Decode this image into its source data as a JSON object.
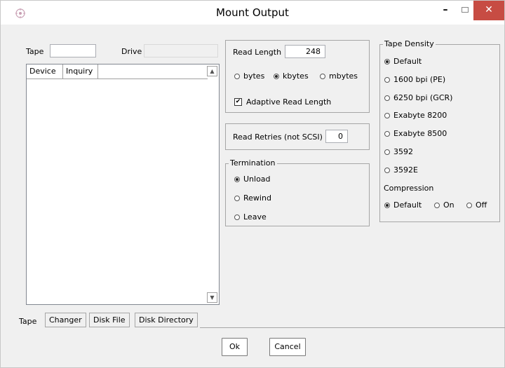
{
  "window": {
    "title": "Mount Output",
    "minimize": "–",
    "close": "✕",
    "accent_close": "#c74c43"
  },
  "tape_panel": {
    "tape_label": "Tape",
    "tape_value": "",
    "drive_label": "Drive",
    "drive_value": "",
    "columns": [
      "Device",
      "Inquiry"
    ]
  },
  "read_length": {
    "label": "Read Length",
    "value": "248",
    "units": [
      {
        "label": "bytes",
        "selected": false
      },
      {
        "label": "kbytes",
        "selected": true
      },
      {
        "label": "mbytes",
        "selected": false
      }
    ],
    "adaptive_label": "Adaptive Read Length",
    "adaptive_checked": true
  },
  "read_retries": {
    "label": "Read Retries (not SCSI)",
    "value": "0"
  },
  "termination": {
    "title": "Termination",
    "options": [
      {
        "label": "Unload",
        "selected": true
      },
      {
        "label": "Rewind",
        "selected": false
      },
      {
        "label": "Leave",
        "selected": false
      }
    ]
  },
  "tape_density": {
    "title": "Tape Density",
    "options": [
      {
        "label": "Default",
        "selected": true
      },
      {
        "label": "1600 bpi (PE)",
        "selected": false
      },
      {
        "label": "6250 bpi (GCR)",
        "selected": false
      },
      {
        "label": "Exabyte 8200",
        "selected": false
      },
      {
        "label": "Exabyte 8500",
        "selected": false
      },
      {
        "label": "3592",
        "selected": false
      },
      {
        "label": "3592E",
        "selected": false
      }
    ],
    "compression_label": "Compression",
    "compression": [
      {
        "label": "Default",
        "selected": true
      },
      {
        "label": "On",
        "selected": false
      },
      {
        "label": "Off",
        "selected": false
      }
    ]
  },
  "tabs": [
    {
      "label": "Tape",
      "active": true
    },
    {
      "label": "Changer",
      "active": false
    },
    {
      "label": "Disk File",
      "active": false
    },
    {
      "label": "Disk Directory",
      "active": false
    }
  ],
  "buttons": {
    "ok": "Ok",
    "cancel": "Cancel"
  }
}
